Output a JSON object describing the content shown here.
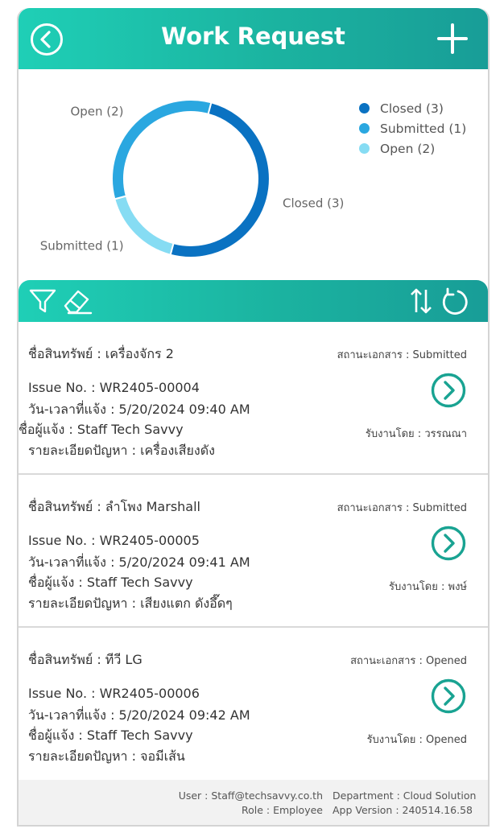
{
  "header": {
    "title": "Work Request"
  },
  "chart_data": {
    "type": "pie",
    "donut": true,
    "categories": [
      "Closed",
      "Submitted",
      "Open"
    ],
    "values": [
      3,
      1,
      2
    ],
    "slice_labels": [
      "Closed (3)",
      "Submitted (1)",
      "Open (2)"
    ],
    "colors": [
      "#0a72c2",
      "#86dcf3",
      "#2aa7e0"
    ],
    "legend_placement": "right",
    "legend": [
      {
        "label": "Closed (3)",
        "color": "#0a72c2"
      },
      {
        "label": "Submitted (1)",
        "color": "#2aa7e0"
      },
      {
        "label": "Open (2)",
        "color": "#86dcf3"
      }
    ]
  },
  "requests": [
    {
      "asset": "ชื่อสินทรัพย์ : เครื่องจักร 2",
      "status": "สถานะเอกสาร : Submitted",
      "issue": "Issue No. : WR2405-00004",
      "datetime": "วัน-เวลาที่แจ้ง : 5/20/2024  09:40 AM",
      "reporter": "ชื่อผู้แจ้ง : Staff Tech Savvy",
      "detail": "รายละเอียดปัญหา : เครื่องเสียงดัง",
      "accepted_by": "รับงานโดย : วรรณณา"
    },
    {
      "asset": "ชื่อสินทรัพย์ : ลำโพง Marshall",
      "status": "สถานะเอกสาร : Submitted",
      "issue": "Issue No. : WR2405-00005",
      "datetime": "วัน-เวลาที่แจ้ง : 5/20/2024  09:41 AM",
      "reporter": "ชื่อผู้แจ้ง : Staff Tech Savvy",
      "detail": "รายละเอียดปัญหา : เสียงแตก ดังอึ๊ดๆ",
      "accepted_by": "รับงานโดย : พงษ์"
    },
    {
      "asset": "ชื่อสินทรัพย์ : ทีวี LG",
      "status": "สถานะเอกสาร : Opened",
      "issue": "Issue No. : WR2405-00006",
      "datetime": "วัน-เวลาที่แจ้ง : 5/20/2024  09:42 AM",
      "reporter": "ชื่อผู้แจ้ง : Staff Tech Savvy",
      "detail": "รายละเอียดปัญหา : จอมีเส้น",
      "accepted_by": "รับงานโดย : Opened"
    }
  ],
  "footer": {
    "user": "User : Staff@techsavvy.co.th",
    "role": "Role : Employee",
    "department": "Department : Cloud Solution",
    "app_version": "App Version : 240514.16.58"
  },
  "icons": {
    "back": "chevron-left-circle-icon",
    "add": "plus-icon",
    "filter": "filter-icon",
    "clear": "eraser-icon",
    "sort": "sort-icon",
    "refresh": "refresh-icon",
    "open": "chevron-right-circle-icon"
  }
}
